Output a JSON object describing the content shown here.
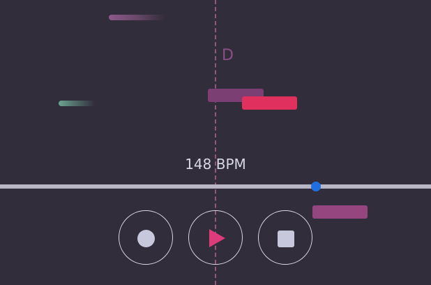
{
  "note_lane": {
    "note_letter": "D"
  },
  "tempo": {
    "bpm_label": "148 BPM"
  },
  "controls": {
    "record_icon": "record-circle",
    "play_icon": "play-triangle",
    "stop_icon": "stop-square"
  },
  "colors": {
    "background": "#322d3b",
    "accent_pink": "#e0305e",
    "play_pink": "#dd3b7a",
    "note_purple": "#7b3f74",
    "slider_blue": "#1f6fe0",
    "control_outline": "#d9d9e6"
  }
}
